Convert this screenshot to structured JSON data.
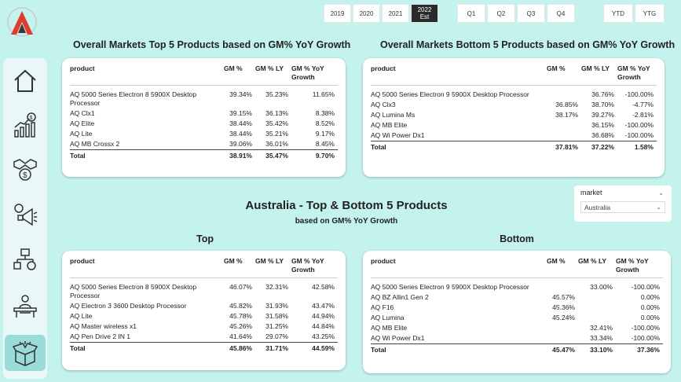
{
  "years": [
    {
      "label": "2019",
      "active": false
    },
    {
      "label": "2020",
      "active": false
    },
    {
      "label": "2021",
      "active": false
    },
    {
      "label": "2022 Est",
      "active": true
    }
  ],
  "quarters": [
    "Q1",
    "Q2",
    "Q3",
    "Q4"
  ],
  "period_buttons": [
    "YTD",
    "YTG"
  ],
  "nav": [
    "home-icon",
    "sales-growth-icon",
    "handshake-money-icon",
    "marketing-megaphone-icon",
    "logistics-icon",
    "manager-desk-icon",
    "product-box-icon"
  ],
  "colors": {
    "background": "#c4f2ed",
    "sidebar": "#e9f8f6",
    "active_nav": "#9adcd7",
    "logo_red": "#e23b2e"
  },
  "overall_top": {
    "title": "Overall Markets Top 5 Products based on GM% YoY Growth",
    "headers": {
      "product": "product",
      "gm": "GM %",
      "gm_ly": "GM % LY",
      "yoy": "GM % YoY Growth"
    },
    "rows": [
      {
        "product": "AQ 5000 Series Electron 8 5900X Desktop Processor",
        "gm": "39.34%",
        "gm_ly": "35.23%",
        "yoy": "11.65%"
      },
      {
        "product": "AQ Clx1",
        "gm": "39.15%",
        "gm_ly": "36.13%",
        "yoy": "8.38%"
      },
      {
        "product": "AQ Elite",
        "gm": "38.44%",
        "gm_ly": "35.42%",
        "yoy": "8.52%"
      },
      {
        "product": "AQ Lite",
        "gm": "38.44%",
        "gm_ly": "35.21%",
        "yoy": "9.17%"
      },
      {
        "product": "AQ MB Crossx 2",
        "gm": "39.06%",
        "gm_ly": "36.01%",
        "yoy": "8.45%"
      }
    ],
    "total": {
      "product": "Total",
      "gm": "38.91%",
      "gm_ly": "35.47%",
      "yoy": "9.70%"
    }
  },
  "overall_bottom": {
    "title": "Overall Markets Bottom 5 Products based on GM% YoY Growth",
    "headers": {
      "product": "product",
      "gm": "GM %",
      "gm_ly": "GM % LY",
      "yoy": "GM % YoY Growth"
    },
    "rows": [
      {
        "product": "AQ 5000 Series Electron 9 5900X Desktop Processor",
        "gm": "",
        "gm_ly": "36.76%",
        "yoy": "-100.00%"
      },
      {
        "product": "AQ Clx3",
        "gm": "36.85%",
        "gm_ly": "38.70%",
        "yoy": "-4.77%"
      },
      {
        "product": "AQ Lumina Ms",
        "gm": "38.17%",
        "gm_ly": "39.27%",
        "yoy": "-2.81%"
      },
      {
        "product": "AQ MB Elite",
        "gm": "",
        "gm_ly": "36.15%",
        "yoy": "-100.00%"
      },
      {
        "product": "AQ Wi Power Dx1",
        "gm": "",
        "gm_ly": "36.68%",
        "yoy": "-100.00%"
      }
    ],
    "total": {
      "product": "Total",
      "gm": "37.81%",
      "gm_ly": "37.22%",
      "yoy": "1.58%"
    }
  },
  "market": {
    "label": "market",
    "value": "Australia"
  },
  "australia": {
    "title": "Australia - Top & Bottom 5 Products",
    "subtitle": "based on GM% YoY Growth",
    "top_label": "Top",
    "bottom_label": "Bottom"
  },
  "aus_top": {
    "headers": {
      "product": "product",
      "gm": "GM %",
      "gm_ly": "GM % LY",
      "yoy": "GM % YoY Growth"
    },
    "rows": [
      {
        "product": "AQ 5000 Series Electron 8 5900X Desktop Processor",
        "gm": "46.07%",
        "gm_ly": "32.31%",
        "yoy": "42.58%"
      },
      {
        "product": "AQ Electron 3 3600 Desktop Processor",
        "gm": "45.82%",
        "gm_ly": "31.93%",
        "yoy": "43.47%"
      },
      {
        "product": "AQ Lite",
        "gm": "45.78%",
        "gm_ly": "31.58%",
        "yoy": "44.94%"
      },
      {
        "product": "AQ Master wireless x1",
        "gm": "45.26%",
        "gm_ly": "31.25%",
        "yoy": "44.84%"
      },
      {
        "product": "AQ Pen Drive 2 IN 1",
        "gm": "41.64%",
        "gm_ly": "29.07%",
        "yoy": "43.25%"
      }
    ],
    "total": {
      "product": "Total",
      "gm": "45.86%",
      "gm_ly": "31.71%",
      "yoy": "44.59%"
    }
  },
  "aus_bottom": {
    "headers": {
      "product": "product",
      "gm": "GM %",
      "gm_ly": "GM % LY",
      "yoy": "GM % YoY Growth"
    },
    "rows": [
      {
        "product": "AQ 5000 Series Electron 9 5900X Desktop Processor",
        "gm": "",
        "gm_ly": "33.00%",
        "yoy": "-100.00%"
      },
      {
        "product": "AQ BZ Allin1 Gen 2",
        "gm": "45.57%",
        "gm_ly": "",
        "yoy": "0.00%"
      },
      {
        "product": "AQ F16",
        "gm": "45.36%",
        "gm_ly": "",
        "yoy": "0.00%"
      },
      {
        "product": "AQ Lumina",
        "gm": "45.24%",
        "gm_ly": "",
        "yoy": "0.00%"
      },
      {
        "product": "AQ MB Elite",
        "gm": "",
        "gm_ly": "32.41%",
        "yoy": "-100.00%"
      },
      {
        "product": "AQ Wi Power Dx1",
        "gm": "",
        "gm_ly": "33.34%",
        "yoy": "-100.00%"
      }
    ],
    "total": {
      "product": "Total",
      "gm": "45.47%",
      "gm_ly": "33.10%",
      "yoy": "37.36%"
    }
  }
}
